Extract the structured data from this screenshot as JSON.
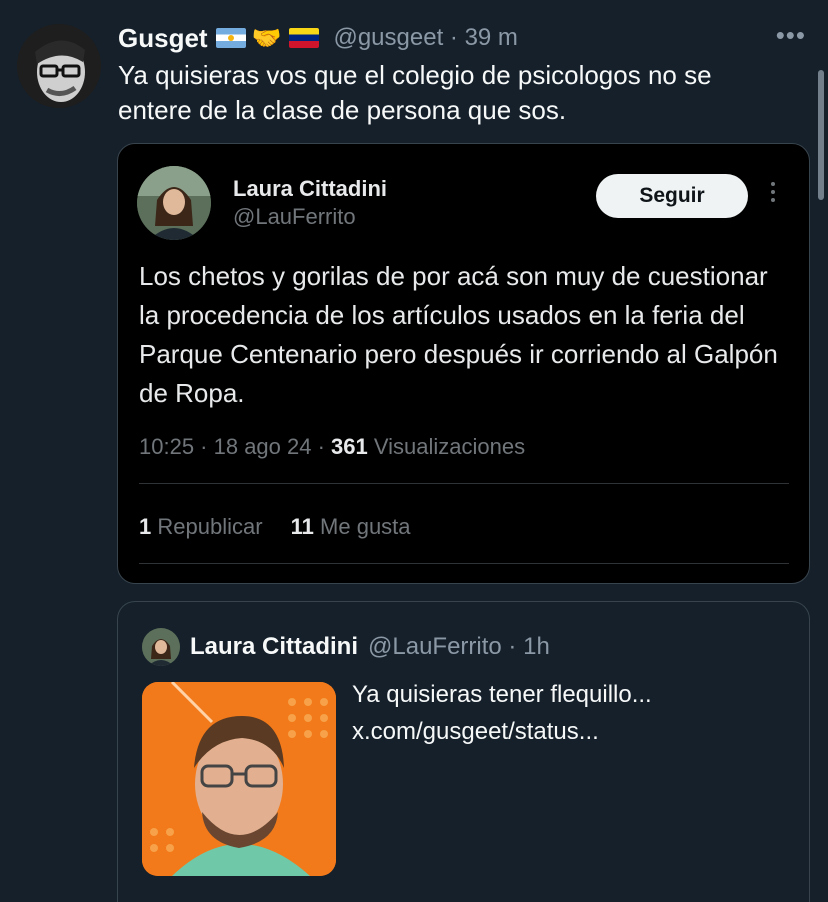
{
  "tweet": {
    "author_name": "Gusget",
    "handle_time": "@gusgeet · 39 m",
    "flags": [
      "argentina-flag",
      "handshake-icon",
      "venezuela-flag"
    ],
    "text": "Ya quisieras vos que el colegio de psicologos no se entere de la clase de persona que sos.",
    "more_icon": "more-horizontal-icon"
  },
  "quoted": {
    "author_name": "Laura Cittadini",
    "handle": "@LauFerrito",
    "follow_label": "Seguir",
    "text": "Los chetos y gorilas de por acá son muy de cuestionar la procedencia de los artículos usados en la feria del Parque Centenario pero después ir corriendo al Galpón de Ropa.",
    "meta_prefix": "10:25 · 18 ago 24 · ",
    "views_count": "361",
    "views_label": " Visualizaciones",
    "reposts_count": "1",
    "reposts_label": " Republicar",
    "likes_count": "11",
    "likes_label": " Me gusta"
  },
  "quoted2": {
    "author_name": "Laura Cittadini",
    "handle_time": "@LauFerrito · 1h",
    "text_line1": "Ya quisieras tener flequillo...",
    "text_line2": "x.com/gusgeet/status..."
  },
  "colors": {
    "background": "#15202b",
    "quote_background": "#000000",
    "secondary_text": "#8b98a5",
    "accent_orange": "#f27a1a"
  }
}
